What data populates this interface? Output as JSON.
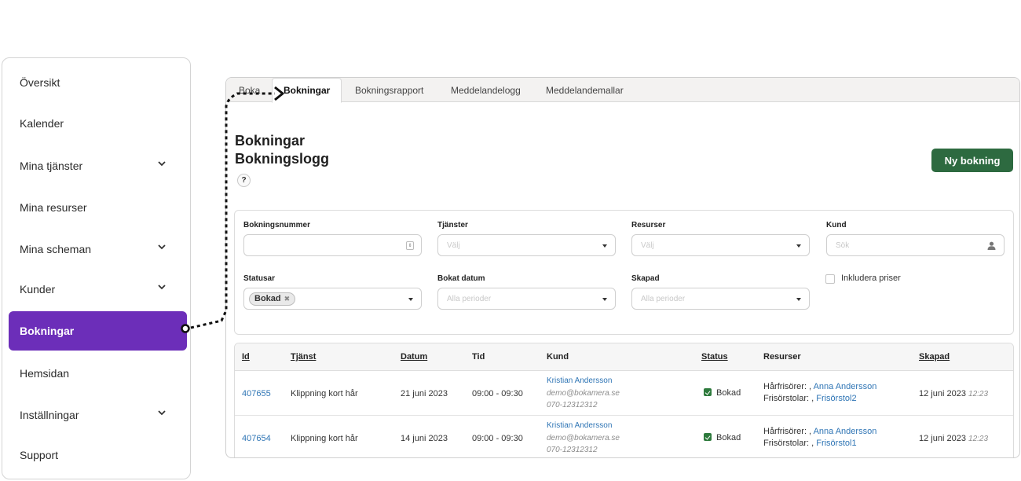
{
  "sidebar": {
    "items": [
      {
        "label": "Översikt",
        "has_children": false
      },
      {
        "label": "Kalender",
        "has_children": false
      },
      {
        "label": "Mina tjänster",
        "has_children": true
      },
      {
        "label": "Mina resurser",
        "has_children": false
      },
      {
        "label": "Mina scheman",
        "has_children": true
      },
      {
        "label": "Kunder",
        "has_children": true
      },
      {
        "label": "Bokningar",
        "has_children": false,
        "active": true
      },
      {
        "label": "Hemsidan",
        "has_children": false
      },
      {
        "label": "Inställningar",
        "has_children": true
      },
      {
        "label": "Support",
        "has_children": false
      }
    ],
    "active_color": "#6c2eb9"
  },
  "tabs": [
    {
      "label": "Boka"
    },
    {
      "label": "Bokningar",
      "active": true
    },
    {
      "label": "Bokningsrapport"
    },
    {
      "label": "Meddelandelogg"
    },
    {
      "label": "Meddelandemallar"
    }
  ],
  "page": {
    "title": "Bokningar",
    "subtitle": "Bokningslogg",
    "help_icon": "?",
    "new_booking_label": "Ny bokning",
    "new_booking_color": "#2d6a40"
  },
  "filters": {
    "booking_number": {
      "label": "Bokningsnummer",
      "value": ""
    },
    "services": {
      "label": "Tjänster",
      "placeholder": "Välj"
    },
    "resources": {
      "label": "Resurser",
      "placeholder": "Välj"
    },
    "customer": {
      "label": "Kund",
      "placeholder": "Sök"
    },
    "statuses": {
      "label": "Statusar",
      "selected": "Bokad",
      "remove": "✖"
    },
    "booked_date": {
      "label": "Bokat datum",
      "placeholder": "Alla perioder"
    },
    "created": {
      "label": "Skapad",
      "placeholder": "Alla perioder"
    },
    "include_prices": {
      "label": "Inkludera priser",
      "checked": false
    }
  },
  "table": {
    "columns": [
      "Id",
      "Tjänst",
      "Datum",
      "Tid",
      "Kund",
      "Status",
      "Resurser",
      "Skapad"
    ],
    "rows": [
      {
        "id": "407655",
        "service": "Klippning kort hår",
        "date": "21 juni 2023",
        "time": "09:00 - 09:30",
        "customer_name": "Kristian Andersson",
        "customer_email": "demo@bokamera.se",
        "customer_phone": "070-12312312",
        "status": "Bokad",
        "res_label_1": "Hårfrisörer: , ",
        "res_value_1": "Anna Andersson",
        "res_label_2": "Frisörstolar: , ",
        "res_value_2": "Frisörstol2",
        "created_date": "12 juni 2023",
        "created_time": "12:23"
      },
      {
        "id": "407654",
        "service": "Klippning kort hår",
        "date": "14 juni 2023",
        "time": "09:00 - 09:30",
        "customer_name": "Kristian Andersson",
        "customer_email": "demo@bokamera.se",
        "customer_phone": "070-12312312",
        "status": "Bokad",
        "res_label_1": "Hårfrisörer: , ",
        "res_value_1": "Anna Andersson",
        "res_label_2": "Frisörstolar: , ",
        "res_value_2": "Frisörstol1",
        "created_date": "12 juni 2023",
        "created_time": "12:23"
      }
    ]
  }
}
